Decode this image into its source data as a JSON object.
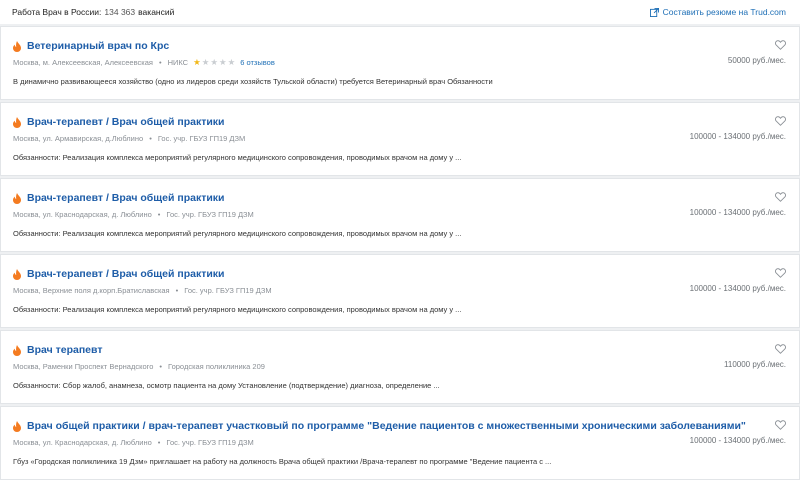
{
  "header": {
    "title": "Работа Врач в России:",
    "count": "134 363",
    "count_unit": "вакансий",
    "resume_link": "Составить резюме на Trud.com",
    "resume_icon": "external-link-icon"
  },
  "colors": {
    "link": "#1e6fb6",
    "title": "#1e5da8",
    "hot": "#f47b20",
    "star": "#f2b818"
  },
  "jobs": [
    {
      "title": "Ветеринарный врач по Крс",
      "location": "Москва, м. Алексеевская, Алексеевская",
      "company": "НИКС",
      "rating": 1,
      "rating_max": 5,
      "reviews": "6 отзывов",
      "salary": "50000 руб./мес.",
      "description": "В динамично развивающееся хозяйство (одно из лидеров среди хозяйств Тульской области) требуется Ветеринарный врач Обязанности"
    },
    {
      "title": "Врач-терапевт / Врач общей практики",
      "location": "Москва, ул. Армавирская, д.Люблино",
      "company": "Гос. учр. ГБУЗ ГП19 ДЗМ",
      "salary": "100000 - 134000 руб./мес.",
      "description": "Обязанности: Реализация комплекса мероприятий регулярного медицинского сопровождения, проводимых врачом на дому у ..."
    },
    {
      "title": "Врач-терапевт / Врач общей практики",
      "location": "Москва, ул. Краснодарская, д. Люблино",
      "company": "Гос. учр. ГБУЗ ГП19 ДЗМ",
      "salary": "100000 - 134000 руб./мес.",
      "description": "Обязанности: Реализация комплекса мероприятий регулярного медицинского сопровождения, проводимых врачом на дому у ..."
    },
    {
      "title": "Врач-терапевт / Врач общей практики",
      "location": "Москва, Верхние поля д.корп.Братиславская",
      "company": "Гос. учр. ГБУЗ ГП19 ДЗМ",
      "salary": "100000 - 134000 руб./мес.",
      "description": "Обязанности: Реализация комплекса мероприятий регулярного медицинского сопровождения, проводимых врачом на дому у ..."
    },
    {
      "title": "Врач терапевт",
      "location": "Москва, Раменки Проспект Вернадского",
      "company": "Городская поликлиника 209",
      "salary": "110000 руб./мес.",
      "description": "Обязанности: Сбор жалоб, анамнеза, осмотр пациента на дому   Установление (подтверждение) диагноза, определение ..."
    },
    {
      "title": "Врач общей практики / врач-терапевт участковый по программе \"Ведение пациентов с множественными хроническими заболеваниями\"",
      "location": "Москва, ул. Краснодарская, д. Люблино",
      "company": "Гос. учр. ГБУЗ ГП19 ДЗМ",
      "salary": "100000 - 134000 руб./мес.",
      "description": "Гбуз «Городская поликлиника 19 Дзм» приглашает на работу на должность Врача общей практики /Врача-терапевт по программе \"Ведение пациента с ..."
    }
  ],
  "icons": {
    "hot": "fire-icon",
    "favorite": "heart-icon",
    "rating": "star-icon"
  }
}
